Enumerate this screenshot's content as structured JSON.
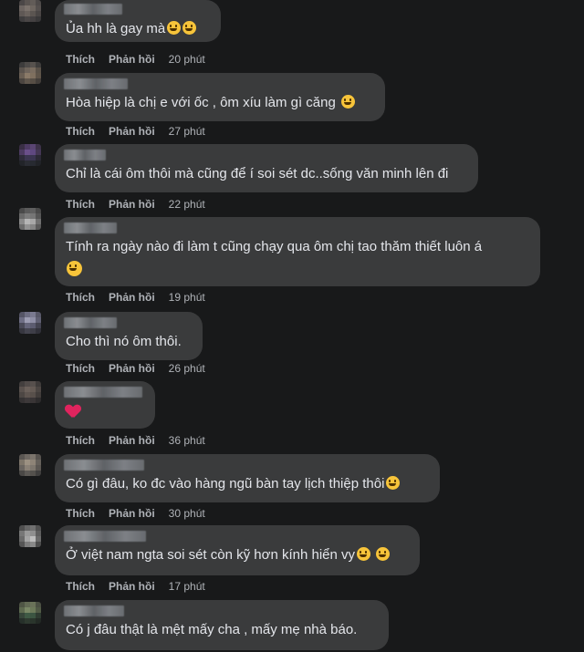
{
  "actions": {
    "like": "Thích",
    "reply": "Phản hồi"
  },
  "comments": [
    {
      "text": "Ủa hh là gay mà",
      "emoji": [
        "grin-emoji",
        "grin-emoji"
      ],
      "time": "20 phút"
    },
    {
      "text": "Hòa hiệp là chị e với ốc , ôm xíu làm gì căng",
      "emoji": [
        "grimace-emoji"
      ],
      "time": "27 phút"
    },
    {
      "text": "Chỉ là cái ôm thôi mà cũng để í soi sét dc..sống văn minh lên đi",
      "emoji": [],
      "time": "22 phút"
    },
    {
      "text": "Tính ra ngày nào đi làm t cũng chạy qua ôm chị tao thăm thiết luôn á",
      "emoji": [
        "smile-emoji"
      ],
      "time": "19 phút"
    },
    {
      "text": "Cho thì nó ôm thôi.",
      "emoji": [],
      "time": "26 phút"
    },
    {
      "text": "",
      "emoji": [
        "heart-icon"
      ],
      "time": "36 phút"
    },
    {
      "text": "Có gì đâu, ko đc vào hàng ngũ bàn tay lịch thiệp thôi",
      "emoji": [
        "laugh-cry-emoji"
      ],
      "time": "30 phút"
    },
    {
      "text": "Ở việt nam ngta soi sét còn kỹ hơn kính hiển vy",
      "emoji": [
        "relieved-emoji",
        "relieved-emoji"
      ],
      "time": "17 phút"
    },
    {
      "text": "Có j đâu thật là mệt mấy cha , mấy mẹ nhà báo.",
      "emoji": [],
      "time": ""
    }
  ]
}
